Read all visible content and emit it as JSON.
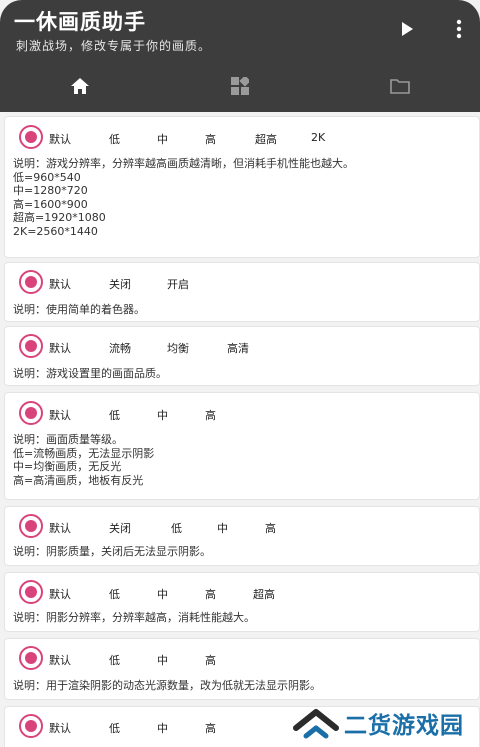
{
  "header": {
    "title": "一休画质助手",
    "subtitle": "刺激战场，修改专属于你的画质。"
  },
  "tabs": [
    {
      "icon": "home-icon",
      "selected": true
    },
    {
      "icon": "dashboard-icon",
      "selected": false
    },
    {
      "icon": "folder-icon",
      "selected": false
    }
  ],
  "colors": {
    "accent": "#d9437c",
    "appbar": "#3d3d3d",
    "watermark": "#1a6fa8"
  },
  "cards": [
    {
      "options": [
        "默认",
        "低",
        "中",
        "高",
        "超高",
        "2K"
      ],
      "description": [
        "说明：游戏分辨率，分辨率越高画质越清晰，但消耗手机性能也越大。",
        "低=960*540",
        "中=1280*720",
        "高=1600*900",
        "超高=1920*1080",
        "2K=2560*1440"
      ]
    },
    {
      "options": [
        "默认",
        "关闭",
        "开启"
      ],
      "description": [
        "说明：使用简单的着色器。"
      ]
    },
    {
      "options": [
        "默认",
        "流畅",
        "均衡",
        "高清"
      ],
      "description": [
        "说明：游戏设置里的画面品质。"
      ]
    },
    {
      "options": [
        "默认",
        "低",
        "中",
        "高"
      ],
      "description": [
        "说明：画面质量等级。",
        "低=流畅画质，无法显示阴影",
        "中=均衡画质，无反光",
        "高=高清画质，地板有反光"
      ]
    },
    {
      "options": [
        "默认",
        "关闭",
        "低",
        "中",
        "高"
      ],
      "description": [
        "说明：阴影质量，关闭后无法显示阴影。"
      ]
    },
    {
      "options": [
        "默认",
        "低",
        "中",
        "高",
        "超高"
      ],
      "description": [
        "说明：阴影分辨率，分辨率越高，消耗性能越大。"
      ]
    },
    {
      "options": [
        "默认",
        "低",
        "中",
        "高"
      ],
      "description": [
        "说明：用于渲染阴影的动态光源数量，改为低就无法显示阴影。"
      ]
    },
    {
      "options": [
        "默认",
        "低",
        "中",
        "高"
      ],
      "description": []
    }
  ],
  "watermark": {
    "text": "二货游戏园"
  }
}
